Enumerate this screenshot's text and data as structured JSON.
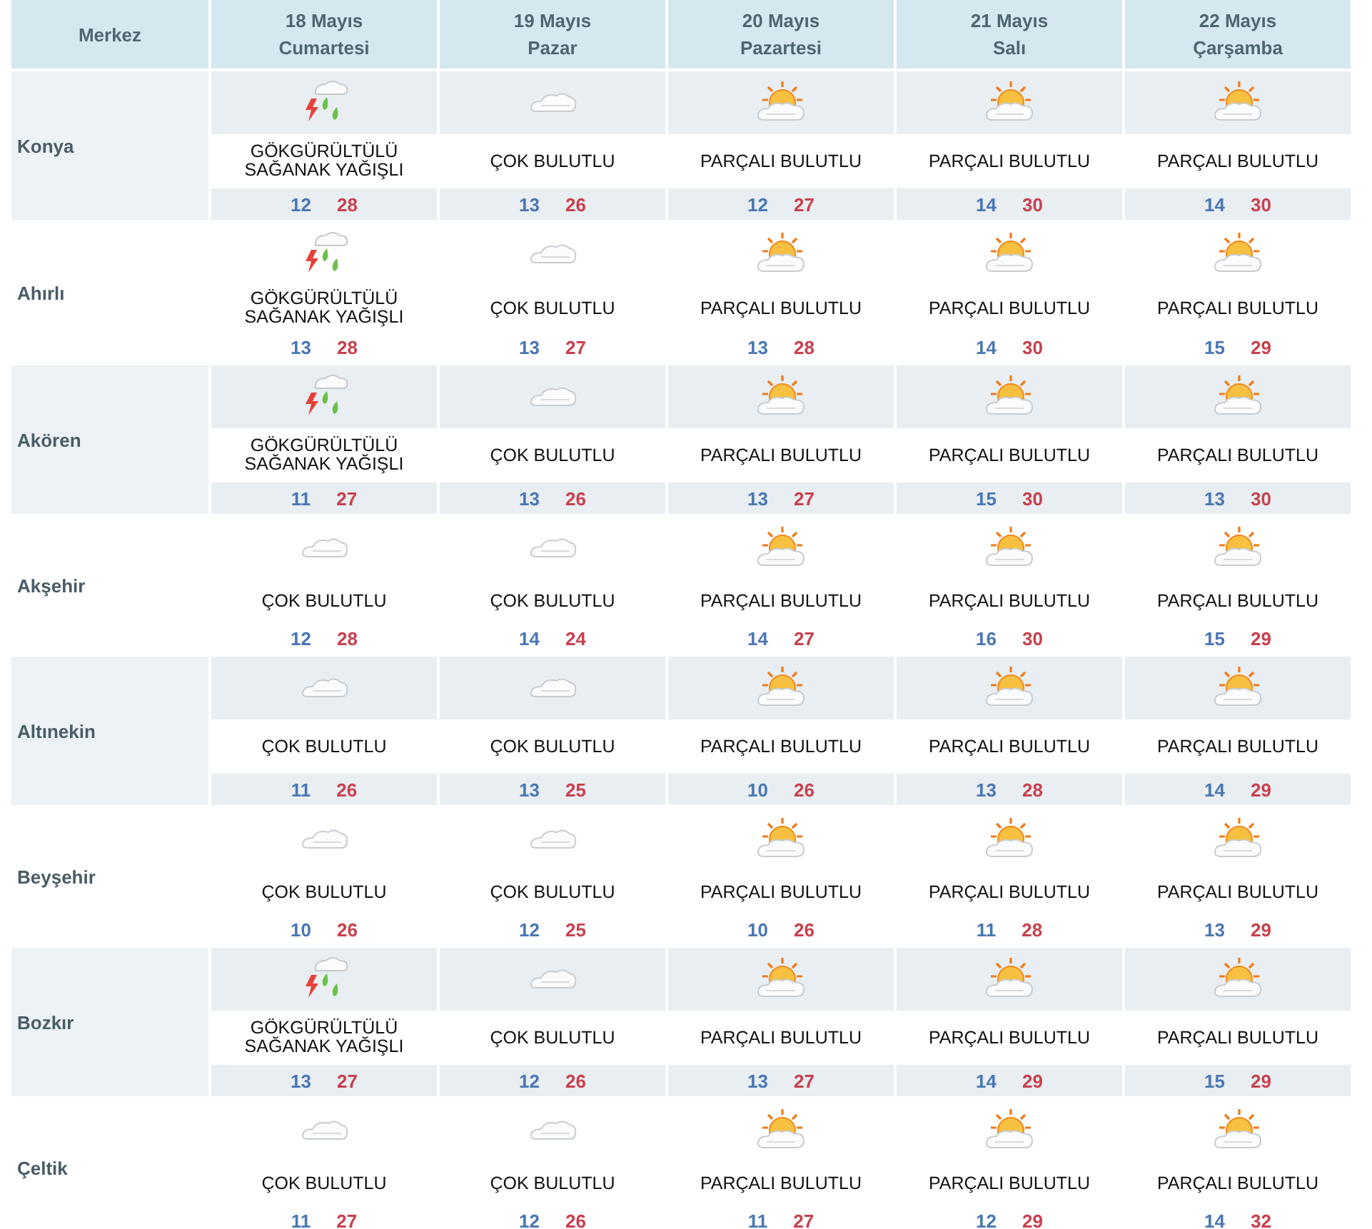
{
  "header": {
    "label": "Merkez",
    "days": [
      {
        "date": "18 Mayıs",
        "weekday": "Cumartesi"
      },
      {
        "date": "19 Mayıs",
        "weekday": "Pazar"
      },
      {
        "date": "20 Mayıs",
        "weekday": "Pazartesi"
      },
      {
        "date": "21 Mayıs",
        "weekday": "Salı"
      },
      {
        "date": "22 Mayıs",
        "weekday": "Çarşamba"
      }
    ]
  },
  "cities": [
    {
      "name": "Konya",
      "forecast": [
        {
          "kind": "storm",
          "condition": "GÖKGÜRÜLTÜLÜ SAĞANAK YAĞIŞLI",
          "low": "12",
          "high": "28"
        },
        {
          "kind": "cloudy",
          "condition": "ÇOK BULUTLU",
          "low": "13",
          "high": "26"
        },
        {
          "kind": "partly",
          "condition": "PARÇALI BULUTLU",
          "low": "12",
          "high": "27"
        },
        {
          "kind": "partly",
          "condition": "PARÇALI BULUTLU",
          "low": "14",
          "high": "30"
        },
        {
          "kind": "partly",
          "condition": "PARÇALI BULUTLU",
          "low": "14",
          "high": "30"
        }
      ]
    },
    {
      "name": "Ahırlı",
      "forecast": [
        {
          "kind": "storm",
          "condition": "GÖKGÜRÜLTÜLÜ SAĞANAK YAĞIŞLI",
          "low": "13",
          "high": "28"
        },
        {
          "kind": "cloudy",
          "condition": "ÇOK BULUTLU",
          "low": "13",
          "high": "27"
        },
        {
          "kind": "partly",
          "condition": "PARÇALI BULUTLU",
          "low": "13",
          "high": "28"
        },
        {
          "kind": "partly",
          "condition": "PARÇALI BULUTLU",
          "low": "14",
          "high": "30"
        },
        {
          "kind": "partly",
          "condition": "PARÇALI BULUTLU",
          "low": "15",
          "high": "29"
        }
      ]
    },
    {
      "name": "Akören",
      "forecast": [
        {
          "kind": "storm",
          "condition": "GÖKGÜRÜLTÜLÜ SAĞANAK YAĞIŞLI",
          "low": "11",
          "high": "27"
        },
        {
          "kind": "cloudy",
          "condition": "ÇOK BULUTLU",
          "low": "13",
          "high": "26"
        },
        {
          "kind": "partly",
          "condition": "PARÇALI BULUTLU",
          "low": "13",
          "high": "27"
        },
        {
          "kind": "partly",
          "condition": "PARÇALI BULUTLU",
          "low": "15",
          "high": "30"
        },
        {
          "kind": "partly",
          "condition": "PARÇALI BULUTLU",
          "low": "13",
          "high": "30"
        }
      ]
    },
    {
      "name": "Akşehir",
      "forecast": [
        {
          "kind": "cloudy",
          "condition": "ÇOK BULUTLU",
          "low": "12",
          "high": "28"
        },
        {
          "kind": "cloudy",
          "condition": "ÇOK BULUTLU",
          "low": "14",
          "high": "24"
        },
        {
          "kind": "partly",
          "condition": "PARÇALI BULUTLU",
          "low": "14",
          "high": "27"
        },
        {
          "kind": "partly",
          "condition": "PARÇALI BULUTLU",
          "low": "16",
          "high": "30"
        },
        {
          "kind": "partly",
          "condition": "PARÇALI BULUTLU",
          "low": "15",
          "high": "29"
        }
      ]
    },
    {
      "name": "Altınekin",
      "forecast": [
        {
          "kind": "cloudy",
          "condition": "ÇOK BULUTLU",
          "low": "11",
          "high": "26"
        },
        {
          "kind": "cloudy",
          "condition": "ÇOK BULUTLU",
          "low": "13",
          "high": "25"
        },
        {
          "kind": "partly",
          "condition": "PARÇALI BULUTLU",
          "low": "10",
          "high": "26"
        },
        {
          "kind": "partly",
          "condition": "PARÇALI BULUTLU",
          "low": "13",
          "high": "28"
        },
        {
          "kind": "partly",
          "condition": "PARÇALI BULUTLU",
          "low": "14",
          "high": "29"
        }
      ]
    },
    {
      "name": "Beyşehir",
      "forecast": [
        {
          "kind": "cloudy",
          "condition": "ÇOK BULUTLU",
          "low": "10",
          "high": "26"
        },
        {
          "kind": "cloudy",
          "condition": "ÇOK BULUTLU",
          "low": "12",
          "high": "25"
        },
        {
          "kind": "partly",
          "condition": "PARÇALI BULUTLU",
          "low": "10",
          "high": "26"
        },
        {
          "kind": "partly",
          "condition": "PARÇALI BULUTLU",
          "low": "11",
          "high": "28"
        },
        {
          "kind": "partly",
          "condition": "PARÇALI BULUTLU",
          "low": "13",
          "high": "29"
        }
      ]
    },
    {
      "name": "Bozkır",
      "forecast": [
        {
          "kind": "storm",
          "condition": "GÖKGÜRÜLTÜLÜ SAĞANAK YAĞIŞLI",
          "low": "13",
          "high": "27"
        },
        {
          "kind": "cloudy",
          "condition": "ÇOK BULUTLU",
          "low": "12",
          "high": "26"
        },
        {
          "kind": "partly",
          "condition": "PARÇALI BULUTLU",
          "low": "13",
          "high": "27"
        },
        {
          "kind": "partly",
          "condition": "PARÇALI BULUTLU",
          "low": "14",
          "high": "29"
        },
        {
          "kind": "partly",
          "condition": "PARÇALI BULUTLU",
          "low": "15",
          "high": "29"
        }
      ]
    },
    {
      "name": "Çeltik",
      "forecast": [
        {
          "kind": "cloudy",
          "condition": "ÇOK BULUTLU",
          "low": "11",
          "high": "27"
        },
        {
          "kind": "cloudy",
          "condition": "ÇOK BULUTLU",
          "low": "12",
          "high": "26"
        },
        {
          "kind": "partly",
          "condition": "PARÇALI BULUTLU",
          "low": "11",
          "high": "27"
        },
        {
          "kind": "partly",
          "condition": "PARÇALI BULUTLU",
          "low": "12",
          "high": "29"
        },
        {
          "kind": "partly",
          "condition": "PARÇALI BULUTLU",
          "low": "14",
          "high": "32"
        }
      ]
    }
  ]
}
